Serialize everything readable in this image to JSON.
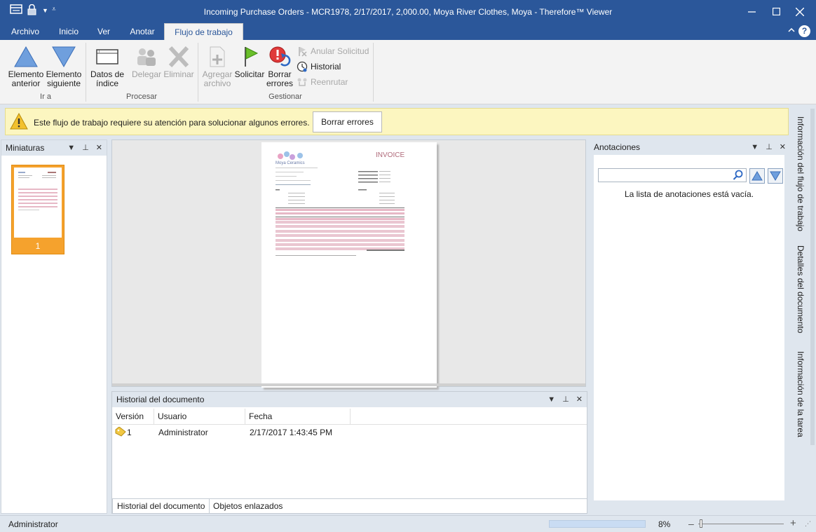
{
  "window": {
    "title": "Incoming Purchase Orders - MCR1978, 2/17/2017, 2,000.00, Moya River Clothes, Moya - Therefore™ Viewer",
    "controls": [
      "minimize",
      "maximize",
      "close"
    ]
  },
  "ribbon_tabs": [
    "Archivo",
    "Inicio",
    "Ver",
    "Anotar",
    "Flujo de trabajo"
  ],
  "active_tab": "Flujo de trabajo",
  "ribbon": {
    "prev": [
      "Elemento",
      "anterior"
    ],
    "next": [
      "Elemento",
      "siguiente"
    ],
    "goto_label": "Ir a",
    "index": [
      "Datos de",
      "índice"
    ],
    "delegate": "Delegar",
    "delete": "Eliminar",
    "process_label": "Procesar",
    "add_file": [
      "Agregar",
      "archivo"
    ],
    "request": "Solicitar",
    "clear_errors": [
      "Borrar",
      "errores"
    ],
    "cancel_request": "Anular Solicitud",
    "history": "Historial",
    "reroute": "Reenrutar",
    "manage_label": "Gestionar"
  },
  "warning": {
    "text": "Este flujo de trabajo requiere su atención para solucionar algunos errores.",
    "button": "Borrar errores"
  },
  "thumbnails": {
    "title": "Miniaturas",
    "page_number": "1"
  },
  "invoice": {
    "company": "Moya Ceramics",
    "heading": "INVOICE"
  },
  "history": {
    "title": "Historial del documento",
    "columns": [
      "Versión",
      "Usuario",
      "Fecha"
    ],
    "rows": [
      {
        "version": "1",
        "user": "Administrator",
        "date": "2/17/2017 1:43:45 PM"
      }
    ],
    "tabs": [
      "Historial del documento",
      "Objetos enlazados"
    ]
  },
  "annotations": {
    "title": "Anotaciones",
    "empty_text": "La lista de anotaciones está vacía.",
    "search_placeholder": ""
  },
  "side_tabs": [
    "Información del flujo de trabajo",
    "Detalles del documento",
    "Información de la tarea"
  ],
  "status": {
    "user": "Administrator",
    "zoom": "8%",
    "progress": 0
  }
}
